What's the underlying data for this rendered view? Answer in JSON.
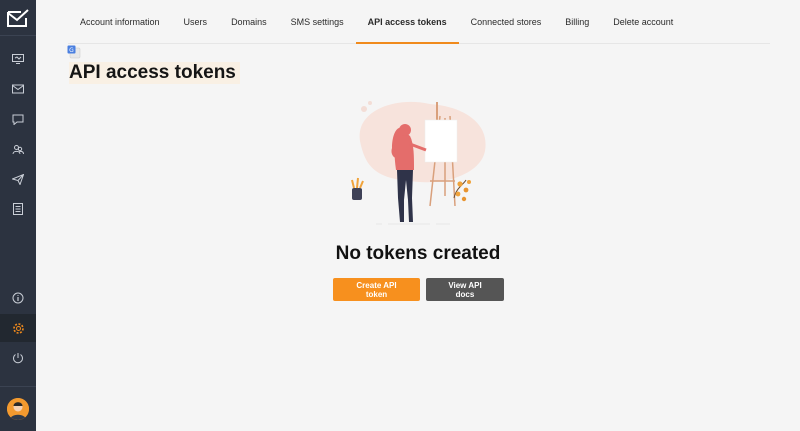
{
  "tabs": [
    {
      "label": "Account information",
      "active": false
    },
    {
      "label": "Users",
      "active": false
    },
    {
      "label": "Domains",
      "active": false
    },
    {
      "label": "SMS settings",
      "active": false
    },
    {
      "label": "API access tokens",
      "active": true
    },
    {
      "label": "Connected stores",
      "active": false
    },
    {
      "label": "Billing",
      "active": false
    },
    {
      "label": "Delete account",
      "active": false
    }
  ],
  "page": {
    "title": "API access tokens",
    "empty_title": "No tokens created",
    "create_label": "Create API token",
    "docs_label": "View API docs"
  },
  "sidebar": {
    "items": [
      "monitor-icon",
      "mail-icon",
      "chat-icon",
      "contacts-icon",
      "send-icon",
      "list-icon"
    ],
    "bottom": [
      "info-icon",
      "settings-icon",
      "power-icon"
    ],
    "active": "settings-icon"
  },
  "colors": {
    "accent": "#f7901e",
    "sidebar": "#2c3340",
    "secondary_button": "#555555"
  }
}
